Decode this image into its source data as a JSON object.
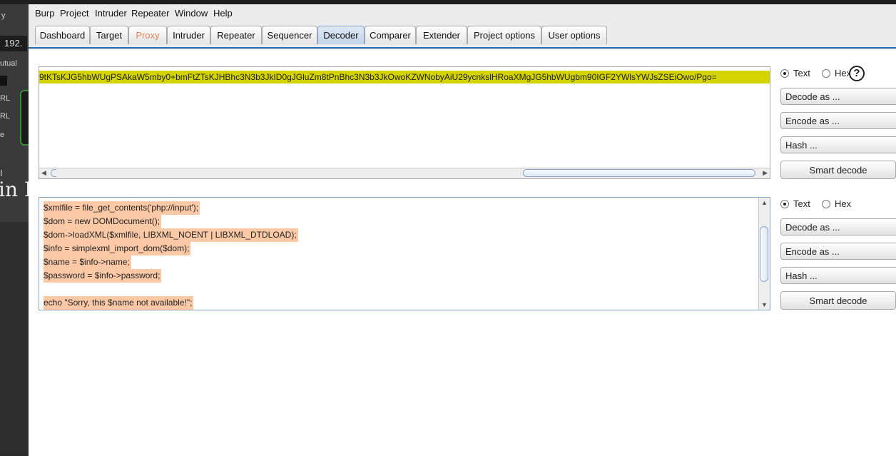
{
  "menu": [
    "Burp",
    "Project",
    "Intruder",
    "Repeater",
    "Window",
    "Help"
  ],
  "tabs": [
    "Dashboard",
    "Target",
    "Proxy",
    "Intruder",
    "Repeater",
    "Sequencer",
    "Decoder",
    "Comparer",
    "Extender",
    "Project options",
    "User options"
  ],
  "active_tab": "Decoder",
  "background_window": {
    "labels": [
      "y",
      "192.",
      "utual",
      "RL",
      "RL",
      "e",
      "I",
      "in I"
    ]
  },
  "decoder": {
    "panel1": {
      "text": "9tKTsKJG5hbWUgPSAkaW5mby0+bmFtZTsKJHBhc3N3b3JkID0gJGluZm8tPnBhc3N3b3JkOwoKZWNobyAiU29ycnkslHRoaXMgJG5hbWUgbm90IGF2YWlsYWJsZSEiOwo/Pgo=",
      "radio_text": "Text",
      "radio_hex": "Hex",
      "selected": "Text",
      "help": "?"
    },
    "panel2": {
      "lines": [
        "$xmlfile = file_get_contents('php://input');",
        "$dom = new DOMDocument();",
        "$dom->loadXML($xmlfile, LIBXML_NOENT | LIBXML_DTDLOAD);",
        "$info = simplexml_import_dom($dom);",
        "$name = $info->name;",
        "$password = $info->password;",
        "",
        "echo \"Sorry, this $name not available!\";"
      ],
      "radio_text": "Text",
      "radio_hex": "Hex",
      "selected": "Text"
    },
    "buttons": {
      "decode": "Decode as ...",
      "encode": "Encode as ...",
      "hash": "Hash ...",
      "smart": "Smart decode"
    }
  },
  "colors": {
    "encoded_highlight": "#d4d400",
    "decoded_highlight": "#fcc9a7",
    "proxy_tab_text": "#e0855a",
    "tab_underline": "#2f6fb4"
  }
}
